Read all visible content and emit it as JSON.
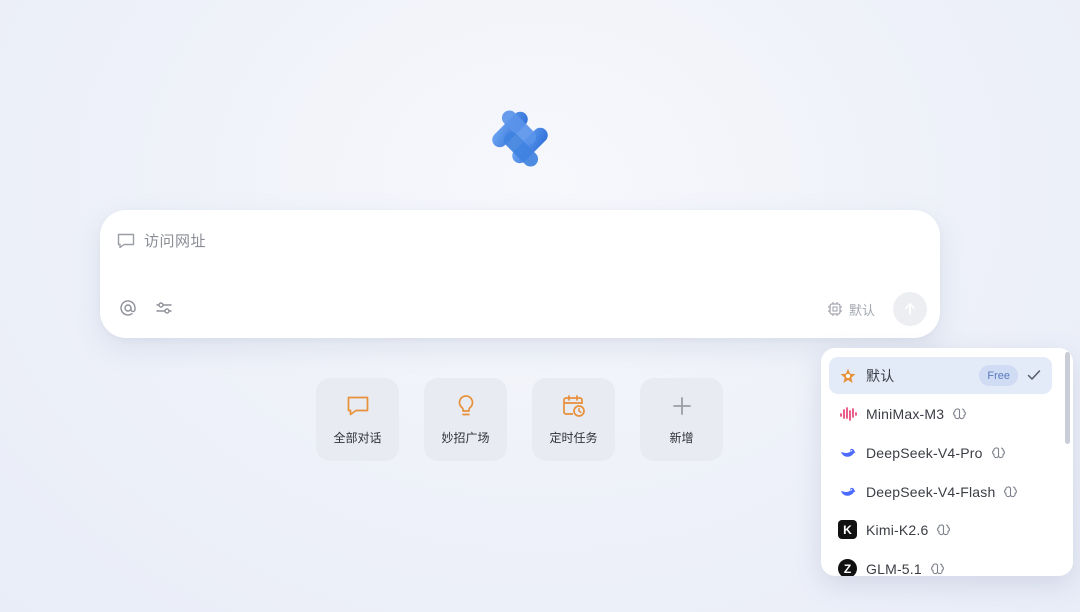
{
  "input": {
    "placeholder": "访问网址",
    "model_label": "默认"
  },
  "quick_actions": [
    {
      "label": "全部对话",
      "icon": "chat-bubble-icon"
    },
    {
      "label": "妙招广场",
      "icon": "lightbulb-icon"
    },
    {
      "label": "定时任务",
      "icon": "calendar-clock-icon"
    },
    {
      "label": "新增",
      "icon": "plus-icon"
    }
  ],
  "model_dropdown": {
    "items": [
      {
        "label": "默认",
        "badge": "Free",
        "selected": true,
        "icon": "default-star-icon"
      },
      {
        "label": "MiniMax-M3",
        "icon": "minimax-icon"
      },
      {
        "label": "DeepSeek-V4-Pro",
        "icon": "deepseek-icon"
      },
      {
        "label": "DeepSeek-V4-Flash",
        "icon": "deepseek-icon"
      },
      {
        "label": "Kimi-K2.6",
        "icon": "kimi-icon",
        "logo_letter": "K"
      },
      {
        "label": "GLM-5.1",
        "icon": "glm-icon",
        "logo_letter": "Z"
      }
    ]
  },
  "colors": {
    "accent_orange": "#e8903a",
    "logo_blue": "#3f82e0",
    "selected_bg": "#e3eaf8",
    "badge_text": "#5a7bc0"
  }
}
